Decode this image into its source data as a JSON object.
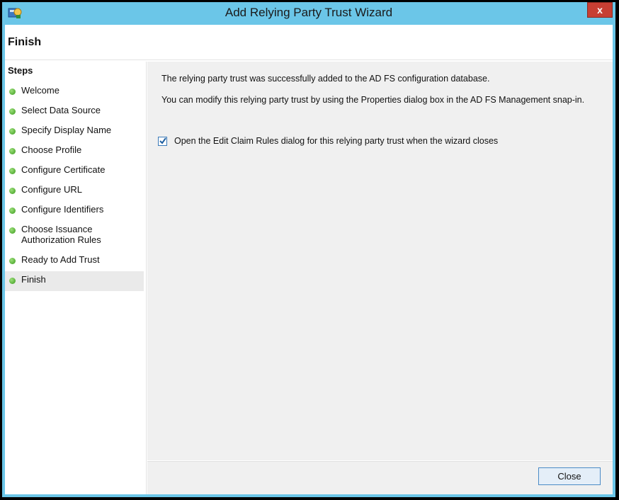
{
  "window": {
    "title": "Add Relying Party Trust Wizard",
    "close_glyph": "x"
  },
  "header": {
    "title": "Finish"
  },
  "sidebar": {
    "heading": "Steps",
    "items": [
      {
        "label": "Welcome"
      },
      {
        "label": "Select Data Source"
      },
      {
        "label": "Specify Display Name"
      },
      {
        "label": "Choose Profile"
      },
      {
        "label": "Configure Certificate"
      },
      {
        "label": "Configure URL"
      },
      {
        "label": "Configure Identifiers"
      },
      {
        "label_line1": "Choose Issuance",
        "label_line2": "Authorization Rules"
      },
      {
        "label": "Ready to Add Trust"
      },
      {
        "label": "Finish"
      }
    ],
    "active_index": 9
  },
  "main": {
    "message1": "The relying party trust was successfully added to the AD FS configuration database.",
    "message2": "You can modify this relying party trust by using the Properties dialog box in the AD FS Management snap-in.",
    "checkbox_label": "Open the Edit Claim Rules dialog for this relying party trust when the wizard closes",
    "checkbox_checked": true
  },
  "footer": {
    "close_label": "Close"
  },
  "colors": {
    "titlebar": "#6bc6e8",
    "step_dot": "#3a9a1d",
    "close_x": "#c73f33"
  },
  "icons": {
    "app": "wizard-app-icon",
    "step": "green-dot-icon",
    "check": "checkmark-icon"
  }
}
